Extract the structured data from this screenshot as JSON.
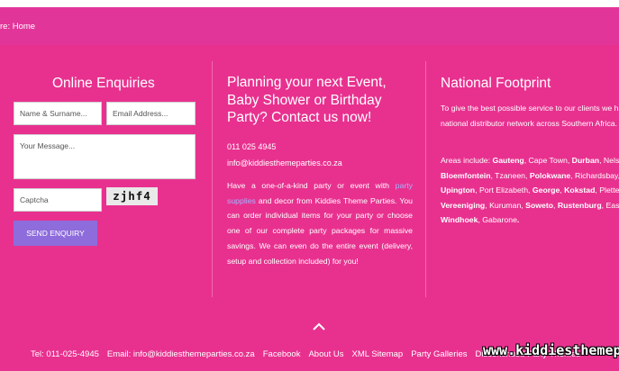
{
  "breadcrumb": "re: Home",
  "enquiry": {
    "title": "Online Enquiries",
    "name_placeholder": "Name & Surname...",
    "email_placeholder": "Email Address...",
    "message_placeholder": "Your Message...",
    "captcha_placeholder": "Captcha",
    "captcha_code": "zjhf4",
    "send_label": "SEND ENQUIRY"
  },
  "planning": {
    "title": "Planning your next Event, Baby Shower or Birthday Party? Contact  us now!",
    "phone": "011 025 4945",
    "email": "info@kiddiesthemeparties.co.za",
    "body_start": "Have a one-of-a-kind party or event with ",
    "body_link": "party supplies",
    "body_end": " and decor from Kiddies Theme Parties. You can order individual items for your party or choose one of our complete party packages for massive savings. We can even do the entire event (delivery, setup and collection included) for you!"
  },
  "footprint": {
    "title": "National Footprint",
    "intro": "To give the best possible service to our clients we have a national distributor network across Southern Africa.",
    "areas_label": "Areas include: ",
    "areas": [
      {
        "text": "Gauteng",
        "bold": true
      },
      {
        "text": ", Cape Town, ",
        "bold": false
      },
      {
        "text": "Durban",
        "bold": true
      },
      {
        "text": ", Nelspruit, ",
        "bold": false
      },
      {
        "text": "Bloemfontein",
        "bold": true
      },
      {
        "text": ", Tzaneen, ",
        "bold": false
      },
      {
        "text": "Polokwane",
        "bold": true
      },
      {
        "text": ", Richardsbay, ",
        "bold": false
      },
      {
        "text": "Upington",
        "bold": true
      },
      {
        "text": ", Port Elizabeth, ",
        "bold": false
      },
      {
        "text": "George",
        "bold": true
      },
      {
        "text": ", ",
        "bold": false
      },
      {
        "text": "Kokstad",
        "bold": true
      },
      {
        "text": ", Plettenberg Bay, ",
        "bold": false
      },
      {
        "text": "Vereeniging",
        "bold": true
      },
      {
        "text": ", Kuruman, ",
        "bold": false
      },
      {
        "text": "Soweto",
        "bold": true
      },
      {
        "text": ", ",
        "bold": false
      },
      {
        "text": "Rustenburg",
        "bold": true
      },
      {
        "text": ", East London, ",
        "bold": false
      },
      {
        "text": "Windhoek",
        "bold": true
      },
      {
        "text": ", Gabarone",
        "bold": false
      },
      {
        "text": ".",
        "bold": true
      }
    ]
  },
  "footer": {
    "links": [
      "Tel: 011-025-4945",
      "Email: info@kiddiesthemeparties.co.za",
      "Facebook",
      "About Us",
      "XML Sitemap",
      "Party Galleries",
      "Discontinued Party Themes"
    ],
    "watermark": "www.kiddiesthemep"
  },
  "icons": {
    "scroll_top": "chevron-up-icon"
  },
  "colors": {
    "topbar": "#e2359a",
    "background": "#e8318f",
    "button": "#8e6cdb",
    "link": "#a8b2ff"
  }
}
